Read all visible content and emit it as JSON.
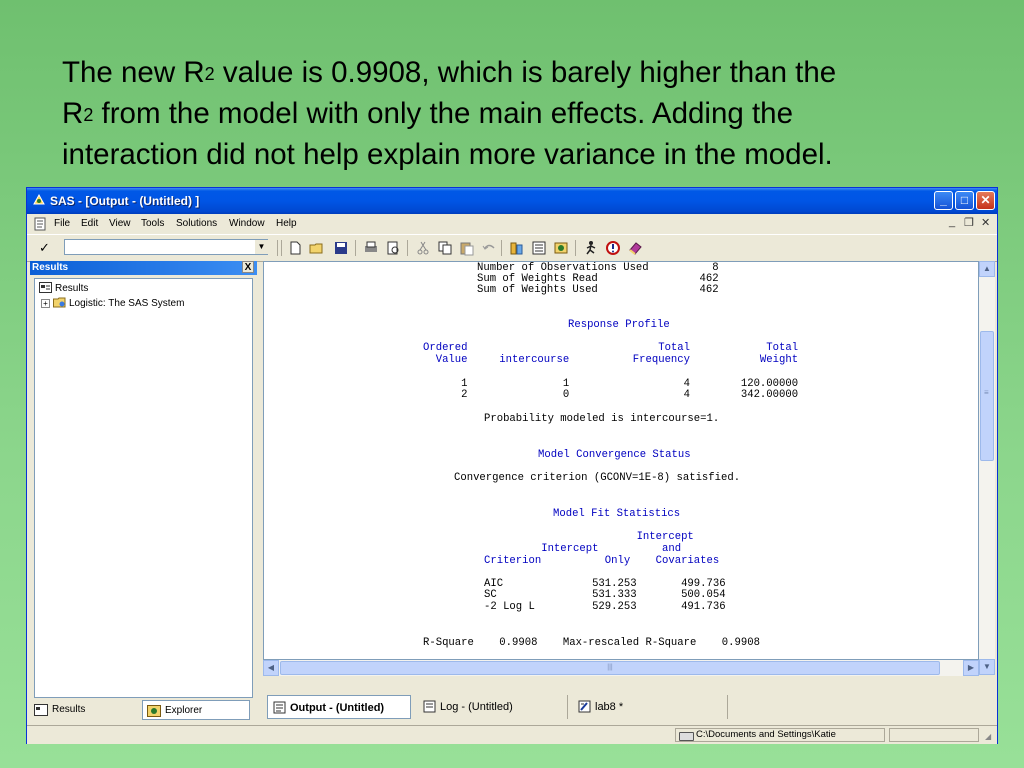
{
  "slide": {
    "line1_a": "The new R",
    "line1_sup": "2",
    "line1_b": " value is 0.9908, which is barely higher than the",
    "line2_a": "R",
    "line2_sup": "2",
    "line2_b": " from the model with only the main effects.  Adding the",
    "line3": "interaction did not help explain more variance in the model."
  },
  "window": {
    "title": "SAS - [Output - (Untitled) ]",
    "minimize": "_",
    "maximize": "□",
    "close": "✕"
  },
  "menu": {
    "items": [
      "File",
      "Edit",
      "View",
      "Tools",
      "Solutions",
      "Window",
      "Help"
    ],
    "mdi_min": "_",
    "mdi_restore": "❐",
    "mdi_close": "✕"
  },
  "toolbar": {
    "check": "✓",
    "command_value": "",
    "dropdown": "▼"
  },
  "results": {
    "header": "Results",
    "close": "X",
    "root": "Results",
    "child": "Logistic:  The SAS System",
    "expander": "+"
  },
  "left_tabs": {
    "results": "Results",
    "explorer": "Explorer"
  },
  "output": {
    "lines": [
      "Number of Observations Used          8",
      "Sum of Weights Read                462",
      "Sum of Weights Used                462",
      "Response Profile",
      "Ordered                              Total            Total",
      "  Value     intercourse          Frequency           Weight",
      "      1               1                  4        120.00000",
      "      2               0                  4        342.00000",
      "Probability modeled is intercourse=1.",
      "Model Convergence Status",
      "Convergence criterion (GCONV=1E-8) satisfied.",
      "Model Fit Statistics",
      "                        Intercept",
      "         Intercept          and",
      "Criterion          Only    Covariates",
      "AIC              531.253       499.736",
      "SC               531.333       500.054",
      "-2 Log L         529.253       491.736",
      "R-Square    0.9908    Max-rescaled R-Square    0.9908"
    ]
  },
  "scroll": {
    "up": "▲",
    "down": "▼",
    "left": "◀",
    "right": "▶",
    "grip": "≡",
    "hgrip": "|||"
  },
  "window_tabs": [
    "Output - (Untitled)",
    "Log - (Untitled)",
    "lab8 *"
  ],
  "status": {
    "path": "C:\\Documents and Settings\\Katie",
    "grip": "◢"
  }
}
